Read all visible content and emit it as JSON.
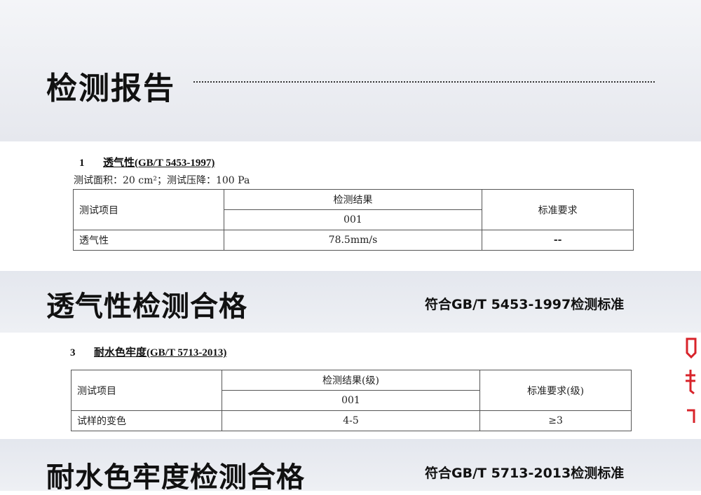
{
  "header": {
    "title": "检测报告"
  },
  "section1": {
    "number": "1",
    "name": "透气性(GB/T 5453-1997)",
    "note": "测试面积：20 cm²；测试压降：100 Pa",
    "table": {
      "col_item": "测试项目",
      "col_result": "检测结果",
      "col_sample": "001",
      "col_standard": "标准要求",
      "row_item": "透气性",
      "row_result": "78.5mm/s",
      "row_standard": "--"
    }
  },
  "banner1": {
    "label": "透气性检测合格",
    "standard": "符合GB/T 5453-1997检测标准"
  },
  "section3": {
    "number": "3",
    "name": "耐水色牢度(GB/T 5713-2013)",
    "table": {
      "col_item": "测试项目",
      "col_result": "检测结果(级)",
      "col_sample": "001",
      "col_standard": "标准要求(级)",
      "row_item": "试样的变色",
      "row_result": "4-5",
      "row_standard": "≥3"
    }
  },
  "banner2": {
    "label": "耐水色牢度检测合格",
    "standard": "符合GB/T 5713-2013检测标准"
  },
  "colors": {
    "band": "#e6e9ef",
    "text": "#111111",
    "accent_red": "#d8232a"
  }
}
